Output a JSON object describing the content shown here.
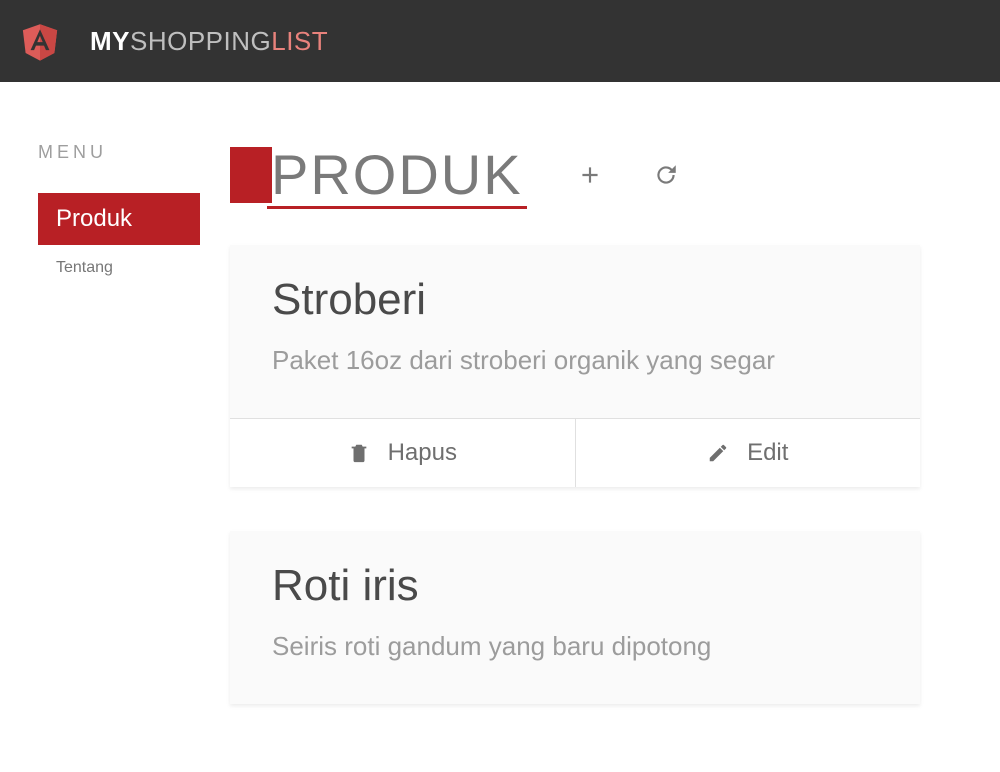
{
  "brand": {
    "part1": "MY",
    "part2": "SHOPPING",
    "part3": "LIST"
  },
  "sidebar": {
    "heading": "MENU",
    "items": [
      {
        "label": "Produk",
        "active": true
      },
      {
        "label": "Tentang",
        "active": false
      }
    ]
  },
  "page": {
    "title": "PRODUK"
  },
  "actions": {
    "delete": "Hapus",
    "edit": "Edit"
  },
  "products": [
    {
      "name": "Stroberi",
      "desc": "Paket 16oz dari stroberi organik yang segar"
    },
    {
      "name": "Roti iris",
      "desc": "Seiris roti gandum yang baru dipotong"
    }
  ]
}
